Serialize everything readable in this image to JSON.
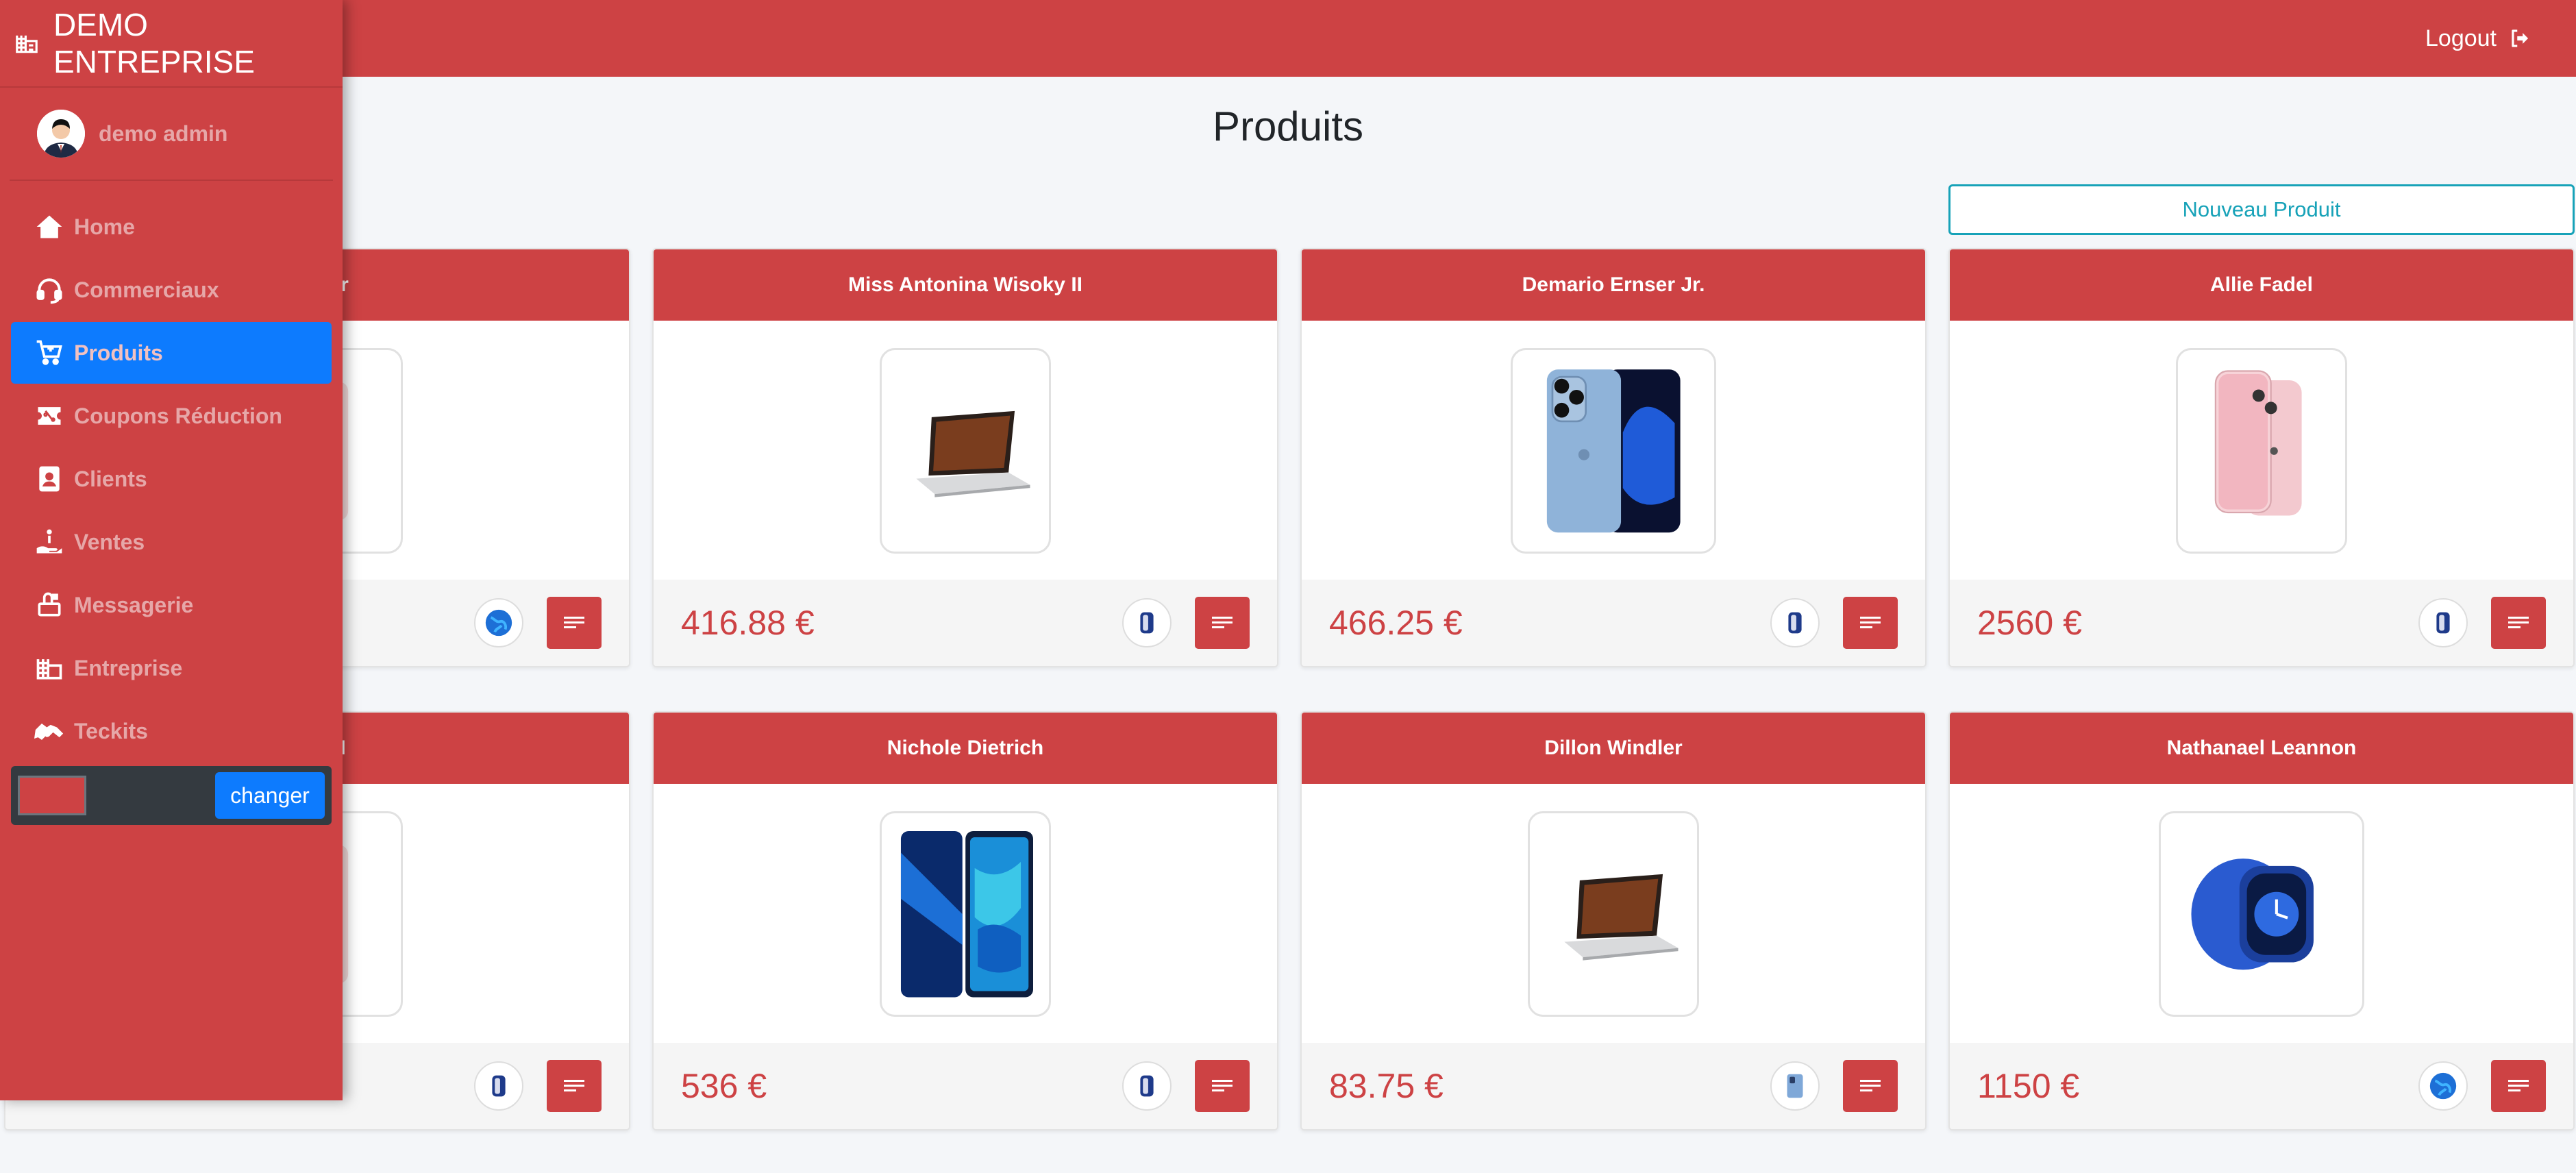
{
  "brand": {
    "name": "DEMO ENTREPRISE"
  },
  "header": {
    "logout_label": "Logout"
  },
  "user": {
    "name": "demo admin"
  },
  "sidebar": {
    "items": [
      {
        "label": "Home",
        "icon": "home-icon"
      },
      {
        "label": "Commerciaux",
        "icon": "headset-icon"
      },
      {
        "label": "Produits",
        "icon": "cart-icon"
      },
      {
        "label": "Coupons Réduction",
        "icon": "ticket-icon"
      },
      {
        "label": "Clients",
        "icon": "contact-icon"
      },
      {
        "label": "Ventes",
        "icon": "hand-coins-icon"
      },
      {
        "label": "Messagerie",
        "icon": "mailbox-icon"
      },
      {
        "label": "Entreprise",
        "icon": "building-icon"
      },
      {
        "label": "Teckits",
        "icon": "handshake-icon"
      }
    ],
    "active_index": 2,
    "color_picker": {
      "value": "#cd4244",
      "button_label": "changer"
    }
  },
  "page": {
    "title": "Produits",
    "new_button_label": "Nouveau Produit"
  },
  "products": [
    {
      "name": "e Beer",
      "price": "",
      "image": "placeholder",
      "thumb": "globe-icon"
    },
    {
      "name": "Miss Antonina Wisoky II",
      "price": "416.88 €",
      "image": "laptop",
      "thumb": "watch-icon"
    },
    {
      "name": "Demario Ernser Jr.",
      "price": "466.25 €",
      "image": "phone-blue",
      "thumb": "watch-icon"
    },
    {
      "name": "Allie Fadel",
      "price": "2560 €",
      "image": "phone-pink",
      "thumb": "watch-icon"
    },
    {
      "name": "Metz I",
      "price": "",
      "image": "placeholder",
      "thumb": "watch-icon"
    },
    {
      "name": "Nichole Dietrich",
      "price": "536 €",
      "image": "phone-huawei",
      "thumb": "watch-icon"
    },
    {
      "name": "Dillon Windler",
      "price": "83.75 €",
      "image": "laptop",
      "thumb": "phone-icon"
    },
    {
      "name": "Nathanael Leannon",
      "price": "1150 €",
      "image": "smartwatch",
      "thumb": "globe-icon"
    }
  ],
  "colors": {
    "primary": "#cd4244",
    "active": "#0d7bfe",
    "outline": "#17a2b8"
  }
}
